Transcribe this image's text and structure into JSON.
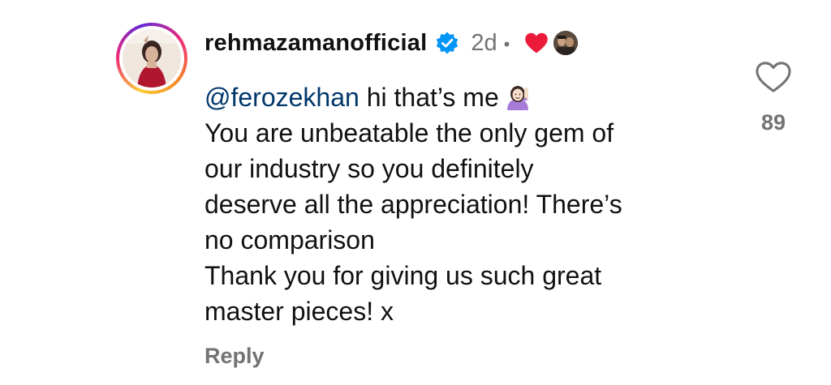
{
  "comment": {
    "username": "rehmazamanofficial",
    "time": "2d",
    "separator": "•",
    "mention": "@ferozekhan",
    "text_lines": [
      " hi that’s me",
      "You are unbeatable the only gem of",
      "our industry so you definitely",
      "deserve all the appreciation! There’s",
      "no comparison",
      "Thank you for giving us such great",
      "master pieces! x"
    ],
    "reply_label": "Reply"
  },
  "likes": {
    "count": "89"
  },
  "icons": {
    "verified": "verified-badge-icon",
    "creator_liked": "red-heart-icon",
    "like": "heart-outline-icon",
    "emoji": "person-raising-hand-emoji"
  },
  "colors": {
    "text": "#111111",
    "muted": "#737373",
    "mention": "#00376b",
    "verified": "#0095f6",
    "heart": "#ed1b3a"
  }
}
